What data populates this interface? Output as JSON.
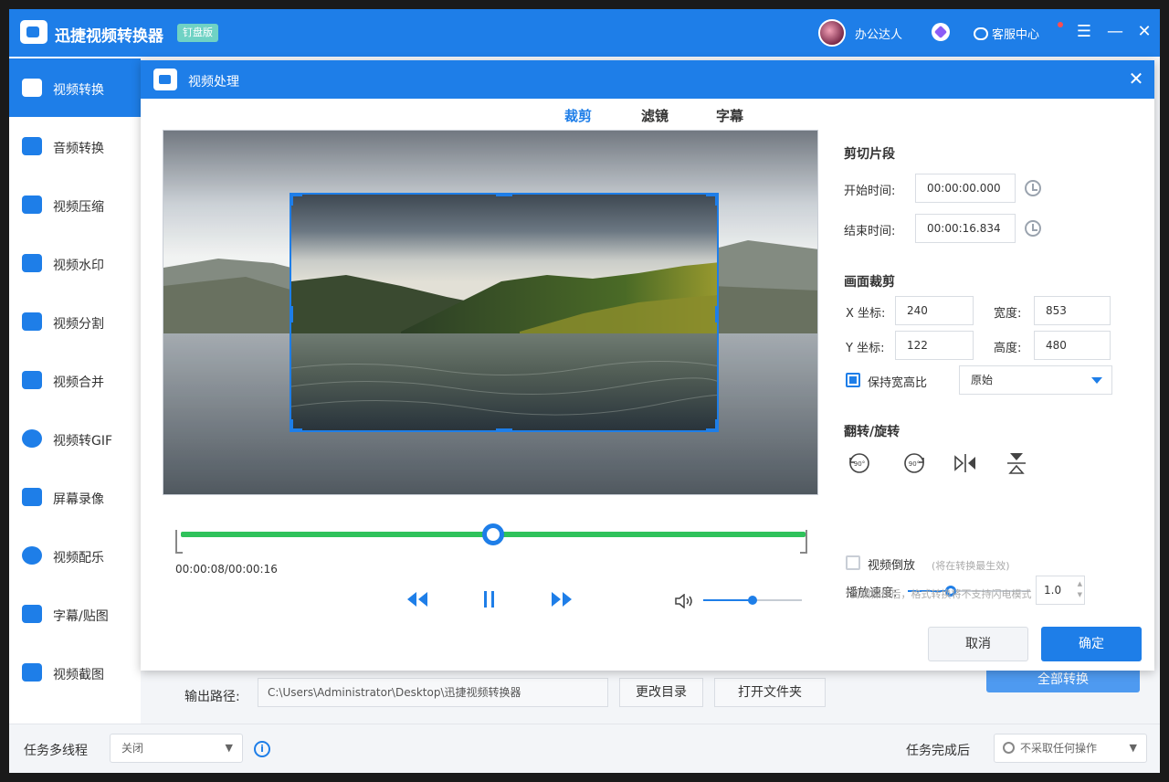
{
  "app": {
    "title": "迅捷视频转换器",
    "edition": "钉盘版",
    "username": "办公达人",
    "support": "客服中心",
    "menu_icon": "menu-icon",
    "minimize_icon": "minimize-icon",
    "close_icon": "close-icon"
  },
  "sidebar": {
    "items": [
      {
        "label": "视频转换",
        "icon": "video-convert-icon",
        "active": true
      },
      {
        "label": "音频转换",
        "icon": "audio-convert-icon"
      },
      {
        "label": "视频压缩",
        "icon": "video-compress-icon"
      },
      {
        "label": "视频水印",
        "icon": "video-watermark-icon"
      },
      {
        "label": "视频分割",
        "icon": "video-split-icon"
      },
      {
        "label": "视频合并",
        "icon": "video-merge-icon"
      },
      {
        "label": "视频转GIF",
        "icon": "video-gif-icon"
      },
      {
        "label": "屏幕录像",
        "icon": "screen-record-icon"
      },
      {
        "label": "视频配乐",
        "icon": "video-music-icon"
      },
      {
        "label": "字幕/贴图",
        "icon": "subtitle-sticker-icon"
      },
      {
        "label": "视频截图",
        "icon": "video-screenshot-icon"
      }
    ]
  },
  "output": {
    "label": "输出路径:",
    "path": "C:\\Users\\Administrator\\Desktop\\迅捷视频转换器",
    "change_dir": "更改目录",
    "open_folder": "打开文件夹",
    "convert_all": "全部转换"
  },
  "bottom": {
    "threads_label": "任务多线程",
    "threads_value": "关闭",
    "after_label": "任务完成后",
    "after_value": "不采取任何操作"
  },
  "dialog": {
    "title": "视频处理",
    "tabs": [
      "裁剪",
      "滤镜",
      "字幕"
    ],
    "active_tab": 0,
    "timecode": "00:00:08/00:00:16",
    "progress": 0.5,
    "volume": 0.5,
    "cut": {
      "title": "剪切片段",
      "start_label": "开始时间:",
      "start_value": "00:00:00.000",
      "end_label": "结束时间:",
      "end_value": "00:00:16.834"
    },
    "crop": {
      "title": "画面裁剪",
      "x_label": "X 坐标:",
      "x_value": "240",
      "y_label": "Y 坐标:",
      "y_value": "122",
      "w_label": "宽度:",
      "w_value": "853",
      "h_label": "高度:",
      "h_value": "480",
      "keep_ratio_label": "保持宽高比",
      "keep_ratio": true,
      "ratio_value": "原始"
    },
    "flip": {
      "title": "翻转/旋转",
      "icons": [
        "rotate-left-90-icon",
        "rotate-right-90-icon",
        "flip-horizontal-icon",
        "flip-vertical-icon"
      ]
    },
    "speed": {
      "label": "播放速度:",
      "value": "1.0",
      "fraction": 0.35
    },
    "reverse": {
      "label": "视频倒放",
      "hint": "(将在转换最生效)",
      "checked": false
    },
    "note": "*剪辑操作后，格式转换将不支持闪电模式",
    "cancel": "取消",
    "confirm": "确定"
  },
  "colors": {
    "primary": "#1e7ee8",
    "timeline": "#2fc25b",
    "accent_teal": "#6fd2c4"
  }
}
